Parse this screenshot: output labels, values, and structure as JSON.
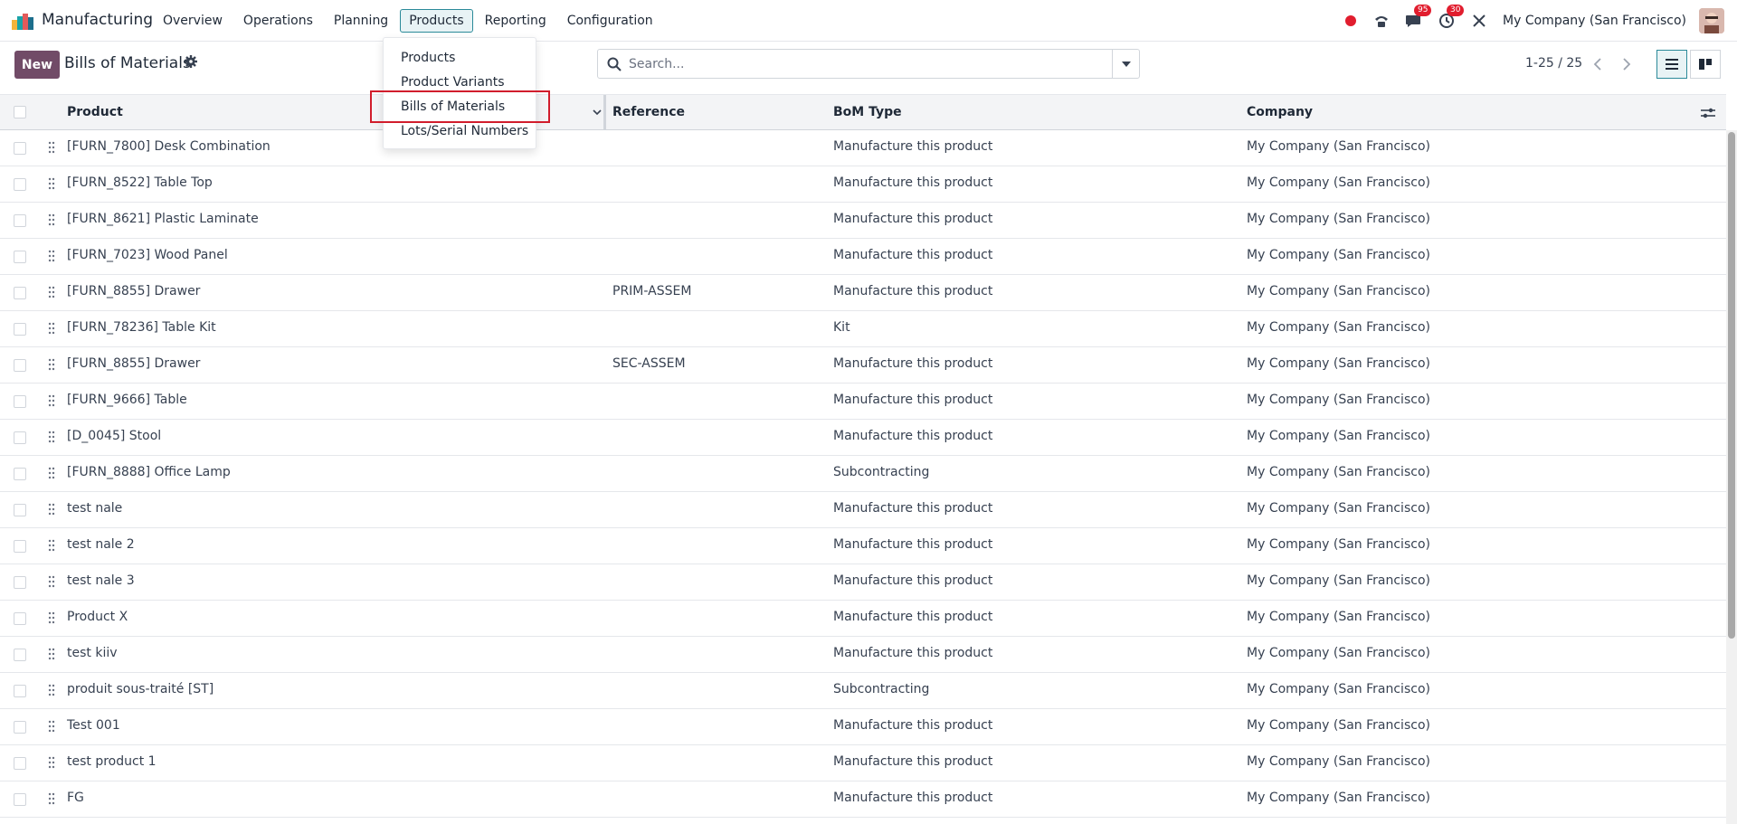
{
  "app": {
    "name": "Manufacturing"
  },
  "nav": {
    "items": [
      {
        "label": "Overview"
      },
      {
        "label": "Operations"
      },
      {
        "label": "Planning"
      },
      {
        "label": "Products"
      },
      {
        "label": "Reporting"
      },
      {
        "label": "Configuration"
      }
    ]
  },
  "tray": {
    "messages_badge": "95",
    "activities_badge": "30",
    "company": "My Company (San Francisco)"
  },
  "control": {
    "new_label": "New",
    "title": "Bills of Materials",
    "search_placeholder": "Search...",
    "pager": "1-25 / 25"
  },
  "dropdown": {
    "items": [
      {
        "label": "Products"
      },
      {
        "label": "Product Variants"
      },
      {
        "label": "Bills of Materials"
      },
      {
        "label": "Lots/Serial Numbers"
      }
    ]
  },
  "table": {
    "headers": {
      "product": "Product",
      "reference": "Reference",
      "bom_type": "BoM Type",
      "company": "Company"
    },
    "rows": [
      {
        "product": "[FURN_7800] Desk Combination",
        "reference": "",
        "bom_type": "Manufacture this product",
        "company": "My Company (San Francisco)"
      },
      {
        "product": "[FURN_8522] Table Top",
        "reference": "",
        "bom_type": "Manufacture this product",
        "company": "My Company (San Francisco)"
      },
      {
        "product": "[FURN_8621] Plastic Laminate",
        "reference": "",
        "bom_type": "Manufacture this product",
        "company": "My Company (San Francisco)"
      },
      {
        "product": "[FURN_7023] Wood Panel",
        "reference": "",
        "bom_type": "Manufacture this product",
        "company": "My Company (San Francisco)"
      },
      {
        "product": "[FURN_8855] Drawer",
        "reference": "PRIM-ASSEM",
        "bom_type": "Manufacture this product",
        "company": "My Company (San Francisco)"
      },
      {
        "product": "[FURN_78236] Table Kit",
        "reference": "",
        "bom_type": "Kit",
        "company": "My Company (San Francisco)"
      },
      {
        "product": "[FURN_8855] Drawer",
        "reference": "SEC-ASSEM",
        "bom_type": "Manufacture this product",
        "company": "My Company (San Francisco)"
      },
      {
        "product": "[FURN_9666] Table",
        "reference": "",
        "bom_type": "Manufacture this product",
        "company": "My Company (San Francisco)"
      },
      {
        "product": "[D_0045] Stool",
        "reference": "",
        "bom_type": "Manufacture this product",
        "company": "My Company (San Francisco)"
      },
      {
        "product": "[FURN_8888] Office Lamp",
        "reference": "",
        "bom_type": "Subcontracting",
        "company": "My Company (San Francisco)"
      },
      {
        "product": "test nale",
        "reference": "",
        "bom_type": "Manufacture this product",
        "company": "My Company (San Francisco)"
      },
      {
        "product": "test nale 2",
        "reference": "",
        "bom_type": "Manufacture this product",
        "company": "My Company (San Francisco)"
      },
      {
        "product": "test nale 3",
        "reference": "",
        "bom_type": "Manufacture this product",
        "company": "My Company (San Francisco)"
      },
      {
        "product": "Product X",
        "reference": "",
        "bom_type": "Manufacture this product",
        "company": "My Company (San Francisco)"
      },
      {
        "product": "test kiiv",
        "reference": "",
        "bom_type": "Manufacture this product",
        "company": "My Company (San Francisco)"
      },
      {
        "product": "produit sous-traité [ST]",
        "reference": "",
        "bom_type": "Subcontracting",
        "company": "My Company (San Francisco)"
      },
      {
        "product": "Test 001",
        "reference": "",
        "bom_type": "Manufacture this product",
        "company": "My Company (San Francisco)"
      },
      {
        "product": "test product 1",
        "reference": "",
        "bom_type": "Manufacture this product",
        "company": "My Company (San Francisco)"
      },
      {
        "product": "FG",
        "reference": "",
        "bom_type": "Manufacture this product",
        "company": "My Company (San Francisco)"
      }
    ]
  }
}
